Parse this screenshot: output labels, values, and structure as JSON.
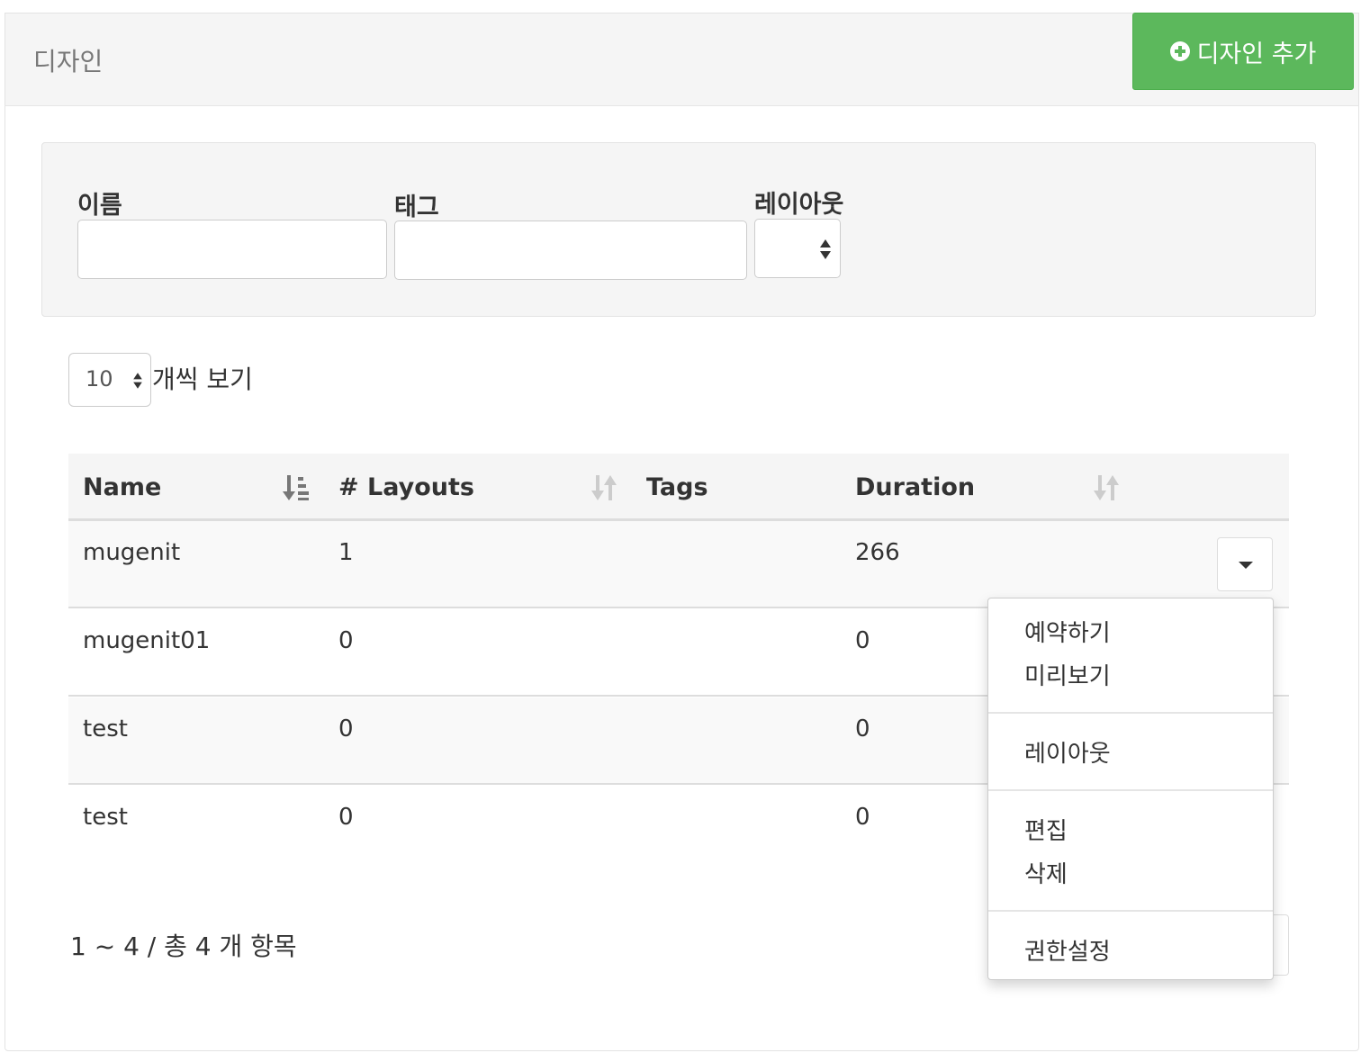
{
  "header": {
    "title": "디자인",
    "add_button_label": "디자인 추가"
  },
  "filters": {
    "name_label": "이름",
    "name_value": "",
    "tag_label": "태그",
    "tag_value": "",
    "layout_label": "레이아웃",
    "layout_value": ""
  },
  "page_length": {
    "value": "10",
    "suffix": "개씩 보기"
  },
  "table": {
    "columns": [
      "Name",
      "# Layouts",
      "Tags",
      "Duration"
    ],
    "rows": [
      {
        "name": "mugenit",
        "layouts": "1",
        "tags": "",
        "duration": "266"
      },
      {
        "name": "mugenit01",
        "layouts": "0",
        "tags": "",
        "duration": "0"
      },
      {
        "name": "test",
        "layouts": "0",
        "tags": "",
        "duration": "0"
      },
      {
        "name": "test",
        "layouts": "0",
        "tags": "",
        "duration": "0"
      }
    ]
  },
  "footer": {
    "info": "1 ~ 4 / 총 4 개 항목"
  },
  "row_menu": {
    "items": [
      "예약하기",
      "미리보기",
      "레이아웃",
      "편집",
      "삭제",
      "권한설정"
    ]
  },
  "colors": {
    "accent_green": "#5cb85c",
    "header_bg": "#f5f5f5"
  }
}
